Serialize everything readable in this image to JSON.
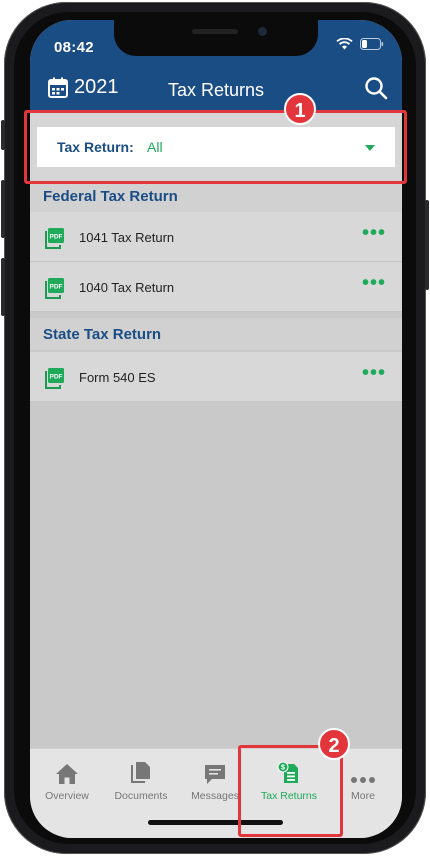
{
  "status": {
    "time": "08:42"
  },
  "header": {
    "year": "2021",
    "title": "Tax Returns"
  },
  "filter": {
    "label": "Tax Return:",
    "value": "All"
  },
  "sections": [
    {
      "title": "Federal Tax Return",
      "items": [
        {
          "label": "1041 Tax Return"
        },
        {
          "label": "1040 Tax Return"
        }
      ]
    },
    {
      "title": "State Tax Return",
      "items": [
        {
          "label": "Form 540 ES"
        }
      ]
    }
  ],
  "tabs": [
    {
      "label": "Overview",
      "icon": "home-icon"
    },
    {
      "label": "Documents",
      "icon": "documents-icon"
    },
    {
      "label": "Messages",
      "icon": "messages-icon"
    },
    {
      "label": "Tax Returns",
      "icon": "tax-returns-icon",
      "active": true
    },
    {
      "label": "More",
      "icon": "more-icon"
    }
  ],
  "annotations": [
    {
      "number": "1"
    },
    {
      "number": "2"
    }
  ],
  "colors": {
    "header_blue": "#1b4d85",
    "accent_green": "#1faa5a",
    "annotation_red": "#e3363c"
  },
  "icons": {
    "pdf": "pdf-icon",
    "row_menu": "ellipsis-icon"
  }
}
